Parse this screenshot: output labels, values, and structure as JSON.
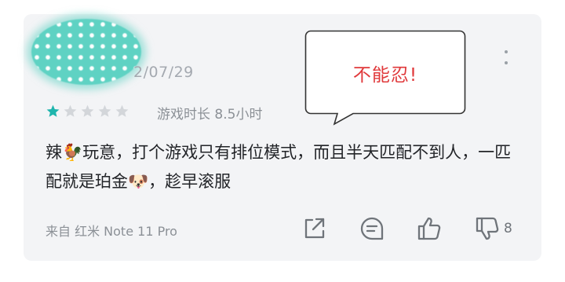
{
  "review": {
    "date": "2/07/29",
    "rating": 1,
    "rating_max": 5,
    "playtime": "游戏时长 8.5小时",
    "text_part1": "辣",
    "emoji_chicken": "🐓",
    "text_part2": "玩意，打个游戏只有排位模式，而且半天匹配不到人，一匹配就是珀金",
    "emoji_dog": "🐶",
    "text_part3": "，趁早滚服",
    "source": "来自 红米 Note 11 Pro",
    "dislike_count": "8"
  },
  "callout": {
    "text": "不能忍!"
  },
  "icons": {
    "share": "share-icon",
    "comment": "comment-icon",
    "like": "thumbs-up-icon",
    "dislike": "thumbs-down-icon",
    "more": "more-vertical-icon",
    "star": "star-icon"
  },
  "colors": {
    "star_filled": "#1fb5ad",
    "star_empty": "#d3d6da",
    "callout_text": "#e0393b",
    "card_bg": "#f3f4f6"
  }
}
